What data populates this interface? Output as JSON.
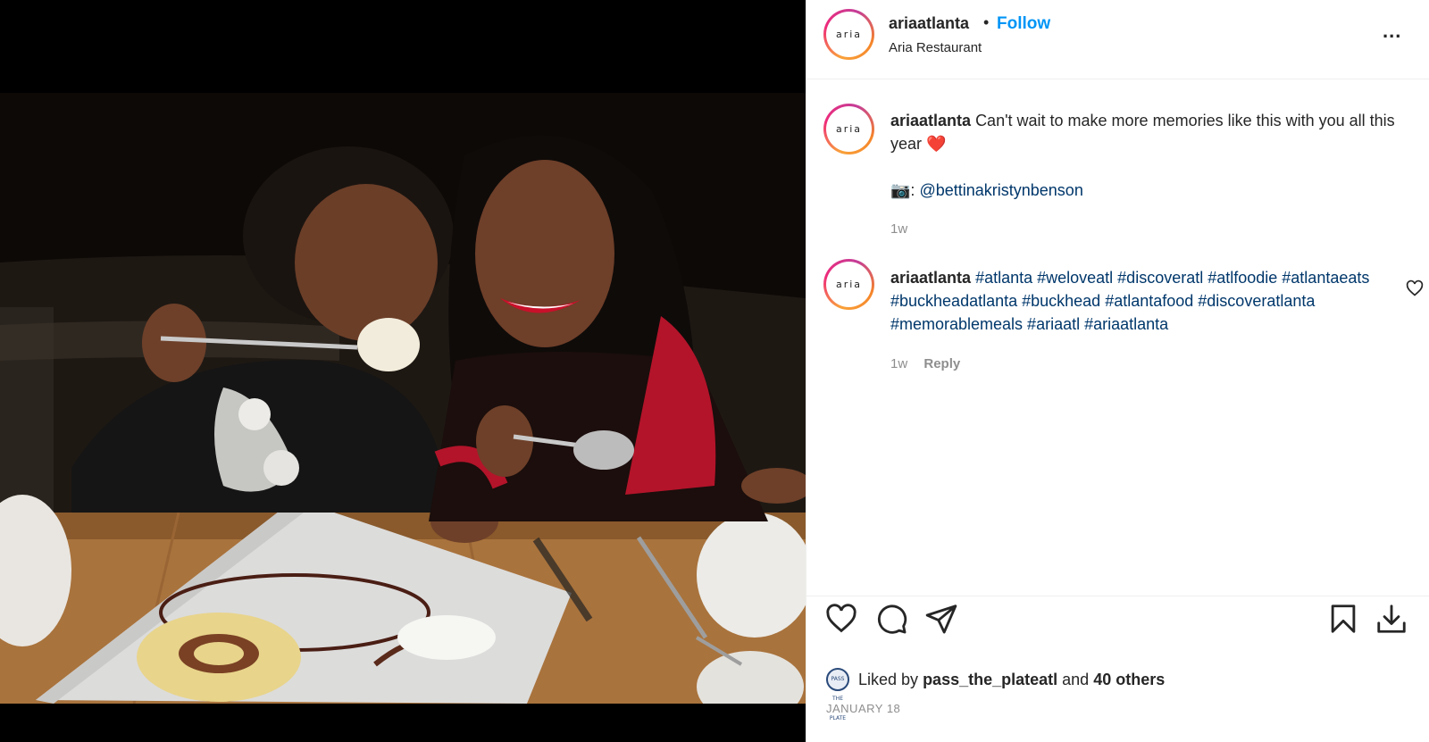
{
  "post": {
    "account": "ariaatlanta",
    "avatar_text": "aria",
    "follow_label": "Follow",
    "separator": "•",
    "location": "Aria Restaurant",
    "more_label": "..."
  },
  "caption": {
    "username": "ariaatlanta",
    "text": "Can't wait to make more memories like this with you all this year",
    "emoji": "❤️",
    "credit_icon": "📷",
    "credit_sep": ":",
    "credit_handle": "@bettinakristynbenson",
    "time": "1w"
  },
  "comment": {
    "username": "ariaatlanta",
    "hashtags": "#atlanta #weloveatl #discoveratl #atlfoodie #atlantaeats #buckheadatlanta #buckhead #atlantafood #discoveratlanta #memorablemeals #ariaatl #ariaatlanta",
    "time": "1w",
    "reply_label": "Reply"
  },
  "actions": {
    "icons": [
      "heart-icon",
      "comment-icon",
      "share-icon",
      "bookmark-icon",
      "download-icon"
    ],
    "liked_by_prefix": "Liked by",
    "liked_by_user": "pass_the_plateatl",
    "liked_by_and": "and",
    "liked_by_others": "40 others",
    "liker_avatar_text": "PASS THE PLATE",
    "date": "JANUARY 18"
  },
  "colors": {
    "follow": "#0095f6",
    "link": "#00376b",
    "muted": "#8e8e8e",
    "heart_emoji": "#e0245e"
  }
}
